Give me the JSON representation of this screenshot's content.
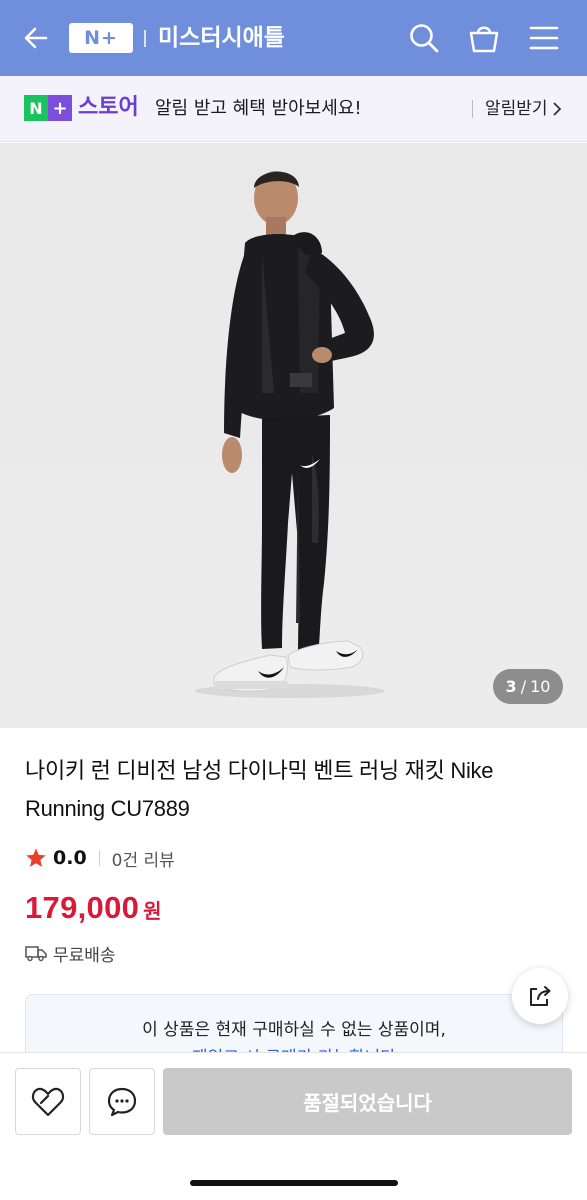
{
  "header": {
    "brand_logo": "N+",
    "store_name": "미스터시애틀",
    "icons": [
      "back-arrow-icon",
      "search-icon",
      "cart-icon",
      "menu-icon"
    ],
    "background_color": "#6f8fdc"
  },
  "notify_banner": {
    "logo_n": "N",
    "logo_plus": "+",
    "store_label": "스토어",
    "message": "알림 받고 혜택 받아보세요!",
    "button_label": "알림받기"
  },
  "product": {
    "image_counter_current": "3",
    "image_counter_total": "10",
    "image_counter_slash": "/",
    "title": "나이키 런 디비전 남성 다이나믹 벤트 러닝 재킷 Nike Running CU7889",
    "rating": "0.0",
    "review_count": "0건 리뷰",
    "price": "179,000",
    "currency": "원",
    "shipping": "무료배송"
  },
  "notice": {
    "line1": "이 상품은 현재 구매하실 수 없는 상품이며,",
    "line2": "재입고 시 구매가 가능합니다"
  },
  "bottom_bar": {
    "soldout_label": "품절되었습니다",
    "icons": [
      "heart-icon",
      "chat-icon"
    ]
  },
  "colors": {
    "accent": "#6f8fdc",
    "price": "#d7193a",
    "star": "#e8412b",
    "naver_green": "#19c35d",
    "naver_purple": "#7b4fd9"
  }
}
